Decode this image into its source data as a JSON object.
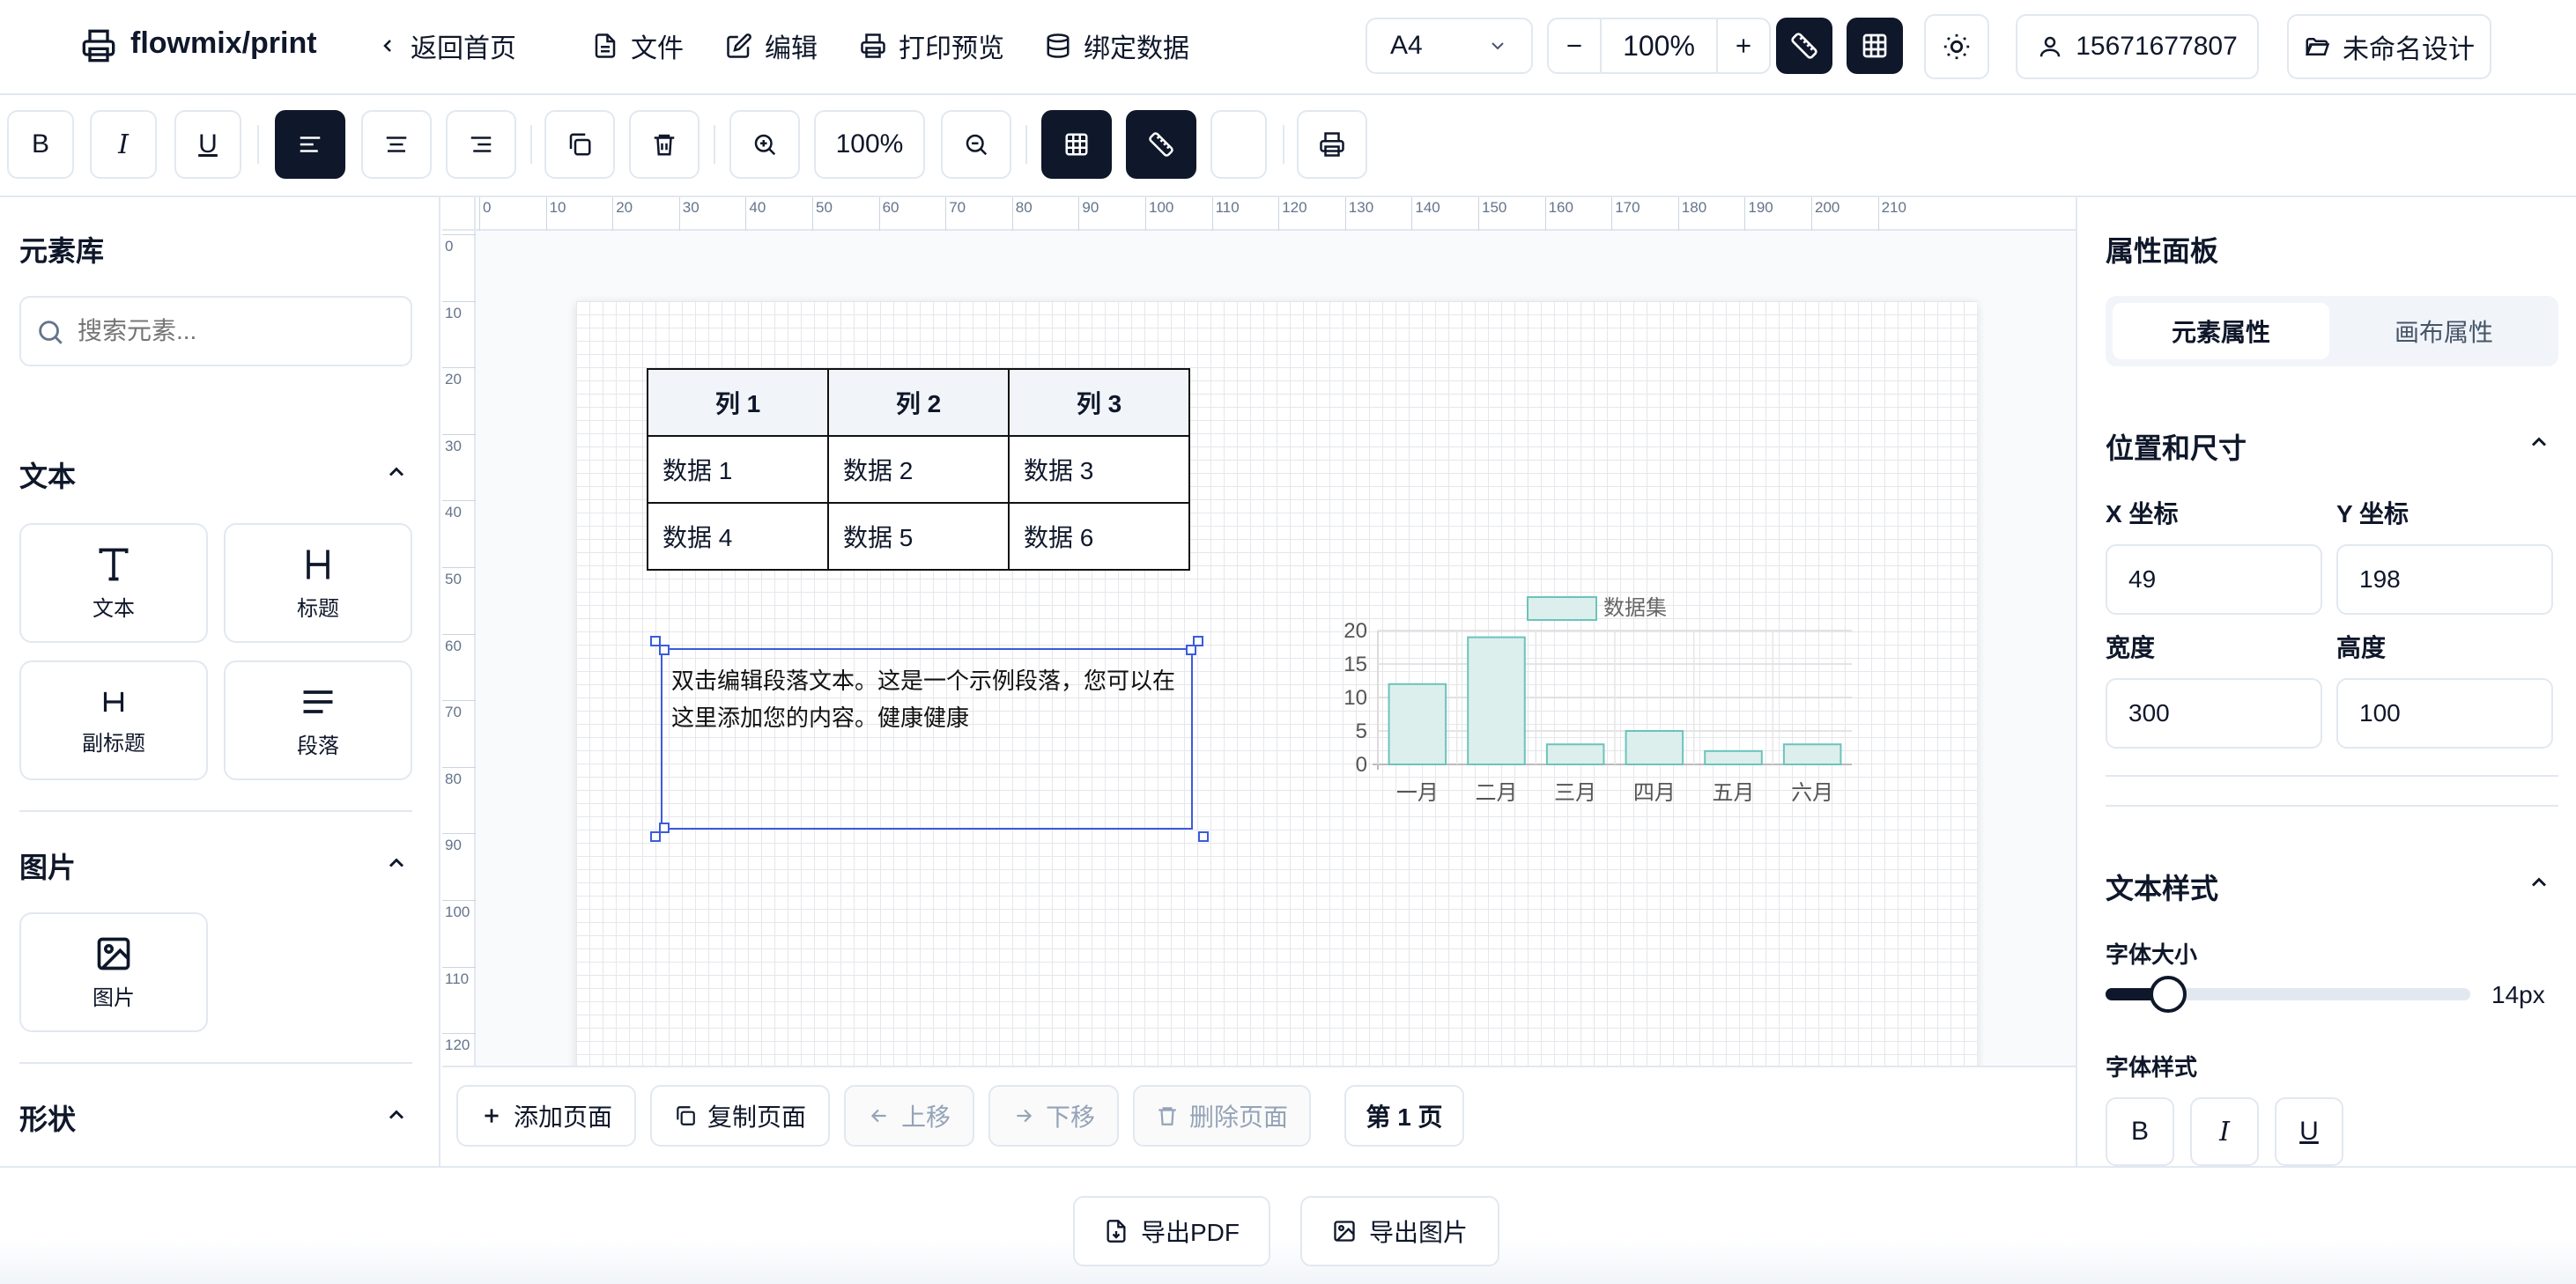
{
  "header": {
    "app_name": "flowmix/print",
    "back_label": "返回首页",
    "nav": [
      "文件",
      "编辑",
      "打印预览",
      "绑定数据"
    ],
    "page_size": "A4",
    "zoom": "100%",
    "user": "15671677807",
    "design_name": "未命名设计"
  },
  "toolbar": {
    "bold": "B",
    "italic": "I",
    "underline": "U",
    "zoom": "100%"
  },
  "sidebar": {
    "title": "元素库",
    "search_placeholder": "搜索元素...",
    "sections": {
      "text": "文本",
      "image": "图片",
      "shape": "形状"
    },
    "text_items": [
      "文本",
      "标题",
      "副标题",
      "段落"
    ],
    "image_items": [
      "图片"
    ]
  },
  "ruler": {
    "h": [
      "0",
      "10",
      "20",
      "30",
      "40",
      "50",
      "60",
      "70",
      "80",
      "90",
      "100",
      "110",
      "120",
      "130",
      "140",
      "150",
      "160",
      "170",
      "180",
      "190",
      "200",
      "210"
    ],
    "v": [
      "0",
      "10",
      "20",
      "30",
      "40",
      "50",
      "60",
      "70",
      "80",
      "90",
      "100",
      "110",
      "120"
    ]
  },
  "canvas": {
    "table": {
      "headers": [
        "列 1",
        "列 2",
        "列 3"
      ],
      "rows": [
        [
          "数据 1",
          "数据 2",
          "数据 3"
        ],
        [
          "数据 4",
          "数据 5",
          "数据 6"
        ]
      ]
    },
    "paragraph": "双击编辑段落文本。这是一个示例段落，您可以在这里添加您的内容。健康健康"
  },
  "chart_data": {
    "type": "bar",
    "categories": [
      "一月",
      "二月",
      "三月",
      "四月",
      "五月",
      "六月"
    ],
    "series": [
      {
        "name": "数据集",
        "values": [
          12,
          19,
          3,
          5,
          2,
          3
        ]
      }
    ],
    "ylim": [
      0,
      20
    ],
    "yticks": [
      "0",
      "5",
      "10",
      "15",
      "20"
    ],
    "legend": "top",
    "colors": {
      "fill": "#dcefed",
      "stroke": "#6cc3bc"
    }
  },
  "pagebar": {
    "add": "添加页面",
    "copy": "复制页面",
    "up": "上移",
    "down": "下移",
    "delete": "删除页面",
    "current": "第 1 页"
  },
  "footer": {
    "export_pdf": "导出PDF",
    "export_image": "导出图片"
  },
  "props": {
    "title": "属性面板",
    "tabs": [
      "元素属性",
      "画布属性"
    ],
    "position_title": "位置和尺寸",
    "x_label": "X 坐标",
    "y_label": "Y 坐标",
    "w_label": "宽度",
    "h_label": "高度",
    "x": "49",
    "y": "198",
    "w": "300",
    "h": "100",
    "text_style_title": "文本样式",
    "font_size_label": "字体大小",
    "font_size": "14px",
    "font_size_level": 0.14,
    "font_style_label": "字体样式",
    "bold": "B",
    "italic": "I",
    "underline": "U"
  }
}
